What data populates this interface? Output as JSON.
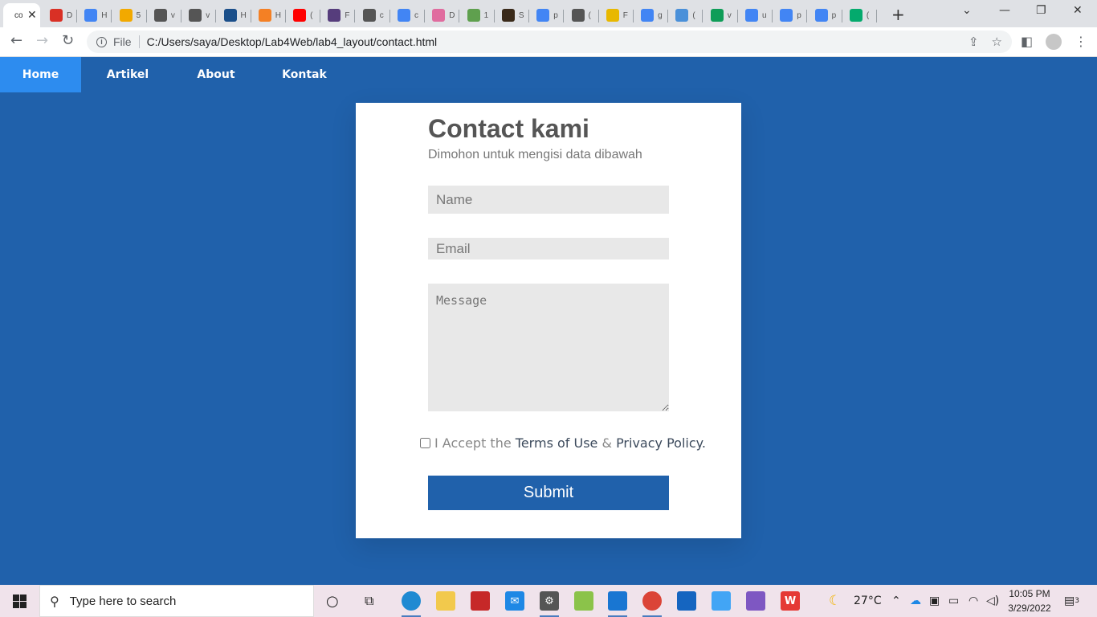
{
  "browser": {
    "active_tab_label": "co",
    "tabs": [
      {
        "label": "D",
        "icon": "heart-icon",
        "color": "#d93025"
      },
      {
        "label": "H",
        "icon": "google-icon",
        "color": "#4285f4"
      },
      {
        "label": "5",
        "icon": "99-icon",
        "color": "#f2a900"
      },
      {
        "label": "v",
        "icon": "github-icon",
        "color": "#555555"
      },
      {
        "label": "v",
        "icon": "github-icon",
        "color": "#555555"
      },
      {
        "label": "H",
        "icon": "circle-icon",
        "color": "#1b4f8a"
      },
      {
        "label": "H",
        "icon": "stackoverflow-icon",
        "color": "#f48024"
      },
      {
        "label": "(",
        "icon": "youtube-icon",
        "color": "#ff0000"
      },
      {
        "label": "F",
        "icon": "bootstrap-icon",
        "color": "#563d7c"
      },
      {
        "label": "c",
        "icon": "github-icon",
        "color": "#555555"
      },
      {
        "label": "c",
        "icon": "google-icon",
        "color": "#4285f4"
      },
      {
        "label": "D",
        "icon": "image-icon",
        "color": "#e06c9f"
      },
      {
        "label": "1",
        "icon": "leaf-icon",
        "color": "#5fa04e"
      },
      {
        "label": "S",
        "icon": "book-icon",
        "color": "#3a2a1a"
      },
      {
        "label": "p",
        "icon": "google-icon",
        "color": "#4285f4"
      },
      {
        "label": "(",
        "icon": "github-icon",
        "color": "#555555"
      },
      {
        "label": "F",
        "icon": "sdr-icon",
        "color": "#e8b800"
      },
      {
        "label": "g",
        "icon": "google-icon",
        "color": "#4285f4"
      },
      {
        "label": "(",
        "icon": "star-icon",
        "color": "#4a90d9"
      },
      {
        "label": "v",
        "icon": "drive-icon",
        "color": "#0f9d58"
      },
      {
        "label": "u",
        "icon": "google-icon",
        "color": "#4285f4"
      },
      {
        "label": "p",
        "icon": "google-icon",
        "color": "#4285f4"
      },
      {
        "label": "p",
        "icon": "google-icon",
        "color": "#4285f4"
      },
      {
        "label": "(",
        "icon": "w3schools-icon",
        "color": "#04aa6d"
      }
    ],
    "scheme": "File",
    "url": "C:/Users/saya/Desktop/Lab4Web/lab4_layout/contact.html"
  },
  "nav": {
    "items": [
      "Home",
      "Artikel",
      "About",
      "Kontak"
    ],
    "active": "Home"
  },
  "form": {
    "title": "Contact kami",
    "subtitle": "Dimohon untuk mengisi data dibawah",
    "name_placeholder": "Name",
    "email_placeholder": "Email",
    "message_placeholder": "Message",
    "accept_prefix": "I Accept the",
    "terms_label": "Terms of Use",
    "amp": "&",
    "privacy_label": "Privacy Policy.",
    "submit_label": "Submit"
  },
  "taskbar": {
    "search_placeholder": "Type here to search",
    "temperature": "27°C",
    "time": "10:05 PM",
    "date": "3/29/2022",
    "notification_count": "3"
  },
  "colors": {
    "page_background": "#2061ab",
    "nav_active": "#2d8cef",
    "submit_button": "#2061ab"
  }
}
